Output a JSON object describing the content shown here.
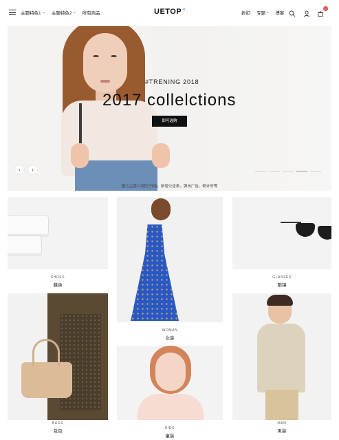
{
  "header": {
    "nav_left": [
      {
        "label": "主题特色1",
        "has_dropdown": true
      },
      {
        "label": "主题特色2",
        "has_dropdown": true
      },
      {
        "label": "所有商品",
        "has_dropdown": false
      }
    ],
    "logo": "UETOP",
    "logo_sup": "21",
    "nav_right": [
      {
        "label": "折扣",
        "has_dropdown": false
      },
      {
        "label": "专题",
        "has_dropdown": true
      },
      {
        "label": "博客",
        "has_dropdown": false
      }
    ],
    "cart_count": "0",
    "icons": [
      "menu-icon",
      "search-icon",
      "user-icon",
      "cart-icon"
    ]
  },
  "hero": {
    "subtitle": "#TRENING 2018",
    "title": "2017 collelctions",
    "button": "即可选购",
    "prev_label": "‹",
    "next_label": "›"
  },
  "notice": "魔方主题2.0版已升级，新增公告条，弹出广告，倒计时等",
  "categories": [
    {
      "en": "SHOES",
      "zh": "鞋类"
    },
    {
      "en": "WOMAN",
      "zh": "女装"
    },
    {
      "en": "GLASSES",
      "zh": "眼镜"
    },
    {
      "en": "BAGS",
      "zh": "包包"
    },
    {
      "en": "KIDS",
      "zh": "童装"
    },
    {
      "en": "MAN",
      "zh": "男装"
    }
  ],
  "colors": {
    "accent_dark": "#111111",
    "badge": "#e64545",
    "logo_sup": "#3a6fd8"
  }
}
